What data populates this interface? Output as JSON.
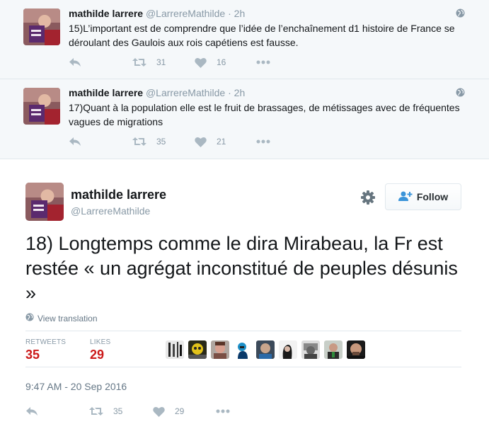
{
  "thread": [
    {
      "fullname": "mathilde larrere",
      "username": "@LarrereMathilde",
      "separator": "·",
      "time": "2h",
      "text": "15)L’important est de comprendre que l’idée de l’enchaînement d1 histoire de France se déroulant des Gaulois aux rois capétiens est fausse.",
      "retweets": "31",
      "likes": "16"
    },
    {
      "fullname": "mathilde larrere",
      "username": "@LarrereMathilde",
      "separator": "·",
      "time": "2h",
      "text": "17)Quant à la population elle est le fruit de brassages, de métissages avec de fréquentes vagues de migrations",
      "retweets": "35",
      "likes": "21"
    }
  ],
  "main": {
    "fullname": "mathilde larrere",
    "username": "@LarrereMathilde",
    "follow_label": "Follow",
    "text": "18) Longtemps comme le dira Mirabeau, la Fr est restée « un agrégat inconstitué de peuples désunis »",
    "translate_label": "View translation",
    "retweets_label": "RETWEETS",
    "retweets": "35",
    "likes_label": "LIKES",
    "likes": "29",
    "timestamp": "9:47 AM - 20 Sep 2016",
    "action_retweets": "35",
    "action_likes": "29"
  },
  "colors": {
    "background_thread": "#f5f8fa",
    "stat_value": "#cc1a1a",
    "muted": "#8899a6",
    "action_icon": "#aab8c2"
  },
  "icons": [
    "reply-icon",
    "retweet-icon",
    "heart-icon",
    "more-icon",
    "globe-icon",
    "gear-icon",
    "follow-person-icon"
  ]
}
